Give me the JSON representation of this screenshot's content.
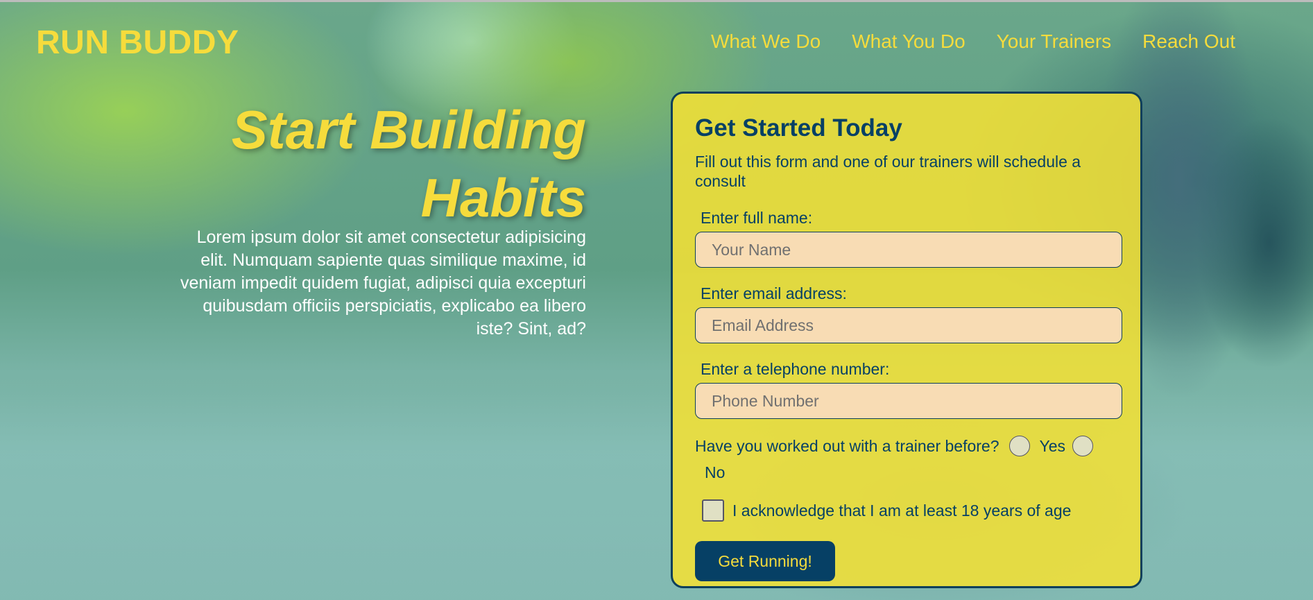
{
  "header": {
    "logo": "RUN BUDDY",
    "nav": [
      "What We Do",
      "What You Do",
      "Your Trainers",
      "Reach Out"
    ]
  },
  "hero": {
    "title": "Start Building Habits",
    "text": "Lorem ipsum dolor sit amet consectetur adipisicing elit. Numquam sapiente quas similique maxime, id veniam impedit quidem fugiat, adipisci quia excepturi quibusdam officiis perspiciatis, explicabo ea libero iste? Sint, ad?"
  },
  "form": {
    "title": "Get Started Today",
    "subtitle": "Fill out this form and one of our trainers will schedule a consult",
    "name_label": "Enter full name:",
    "name_placeholder": "Your Name",
    "email_label": "Enter email address:",
    "email_placeholder": "Email Address",
    "phone_label": "Enter a telephone number:",
    "phone_placeholder": "Phone Number",
    "trainer_question": "Have you worked out with a trainer before?",
    "yes_label": "Yes",
    "no_label": "No",
    "age_ack": "I acknowledge that I am at least 18 years of age",
    "submit_label": "Get Running!"
  },
  "colors": {
    "accent_yellow": "#f6dc3c",
    "navy": "#064065",
    "input_fill": "#f8dcb4"
  }
}
